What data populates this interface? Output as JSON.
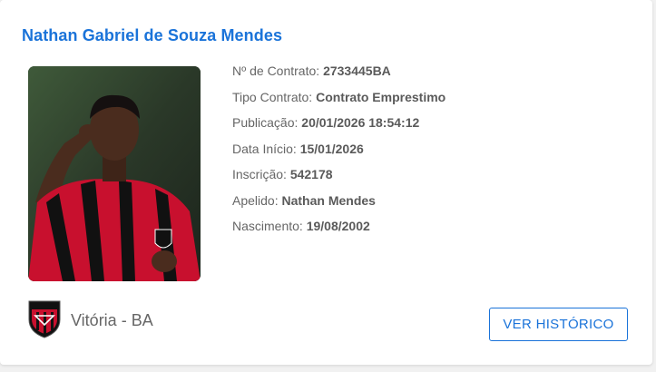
{
  "player": {
    "name": "Nathan Gabriel de Souza Mendes",
    "photo_icon": "player-photo"
  },
  "details": [
    {
      "label": "Nº de Contrato:",
      "value": "2733445BA"
    },
    {
      "label": "Tipo Contrato:",
      "value": "Contrato Emprestimo"
    },
    {
      "label": "Publicação:",
      "value": "20/01/2026 18:54:12"
    },
    {
      "label": "Data Início:",
      "value": "15/01/2026"
    },
    {
      "label": "Inscrição:",
      "value": "542178"
    },
    {
      "label": "Apelido:",
      "value": "Nathan Mendes"
    },
    {
      "label": "Nascimento:",
      "value": "19/08/2002"
    }
  ],
  "club": {
    "name": "Vitória - BA",
    "crest_icon": "club-crest-icon"
  },
  "actions": {
    "history_label": "VER HISTÓRICO"
  },
  "colors": {
    "accent": "#1a73d9",
    "text": "#666666",
    "kit_red": "#c8102e",
    "kit_black": "#111111"
  }
}
